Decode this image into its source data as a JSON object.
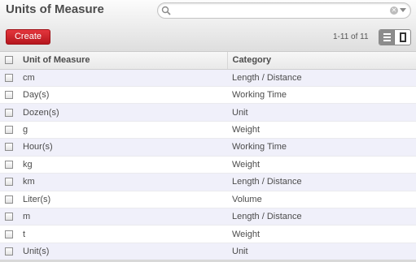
{
  "header": {
    "title": "Units of Measure",
    "search": {
      "value": "",
      "placeholder": ""
    }
  },
  "toolbar": {
    "create_label": "Create",
    "pager": "1-11 of 11"
  },
  "icons": {
    "search": "magnifier-icon",
    "clear": "clear-icon",
    "dropdown": "caret-down-icon",
    "list_view": "list-view-icon",
    "form_view": "form-view-icon"
  },
  "colors": {
    "create_button": "#c9252c",
    "row_stripe": "#f0f0fa"
  },
  "table": {
    "columns": [
      "Unit of Measure",
      "Category"
    ],
    "rows": [
      {
        "unit": "cm",
        "category": "Length / Distance"
      },
      {
        "unit": "Day(s)",
        "category": "Working Time"
      },
      {
        "unit": "Dozen(s)",
        "category": "Unit"
      },
      {
        "unit": "g",
        "category": "Weight"
      },
      {
        "unit": "Hour(s)",
        "category": "Working Time"
      },
      {
        "unit": "kg",
        "category": "Weight"
      },
      {
        "unit": "km",
        "category": "Length / Distance"
      },
      {
        "unit": "Liter(s)",
        "category": "Volume"
      },
      {
        "unit": "m",
        "category": "Length / Distance"
      },
      {
        "unit": "t",
        "category": "Weight"
      },
      {
        "unit": "Unit(s)",
        "category": "Unit"
      }
    ]
  }
}
